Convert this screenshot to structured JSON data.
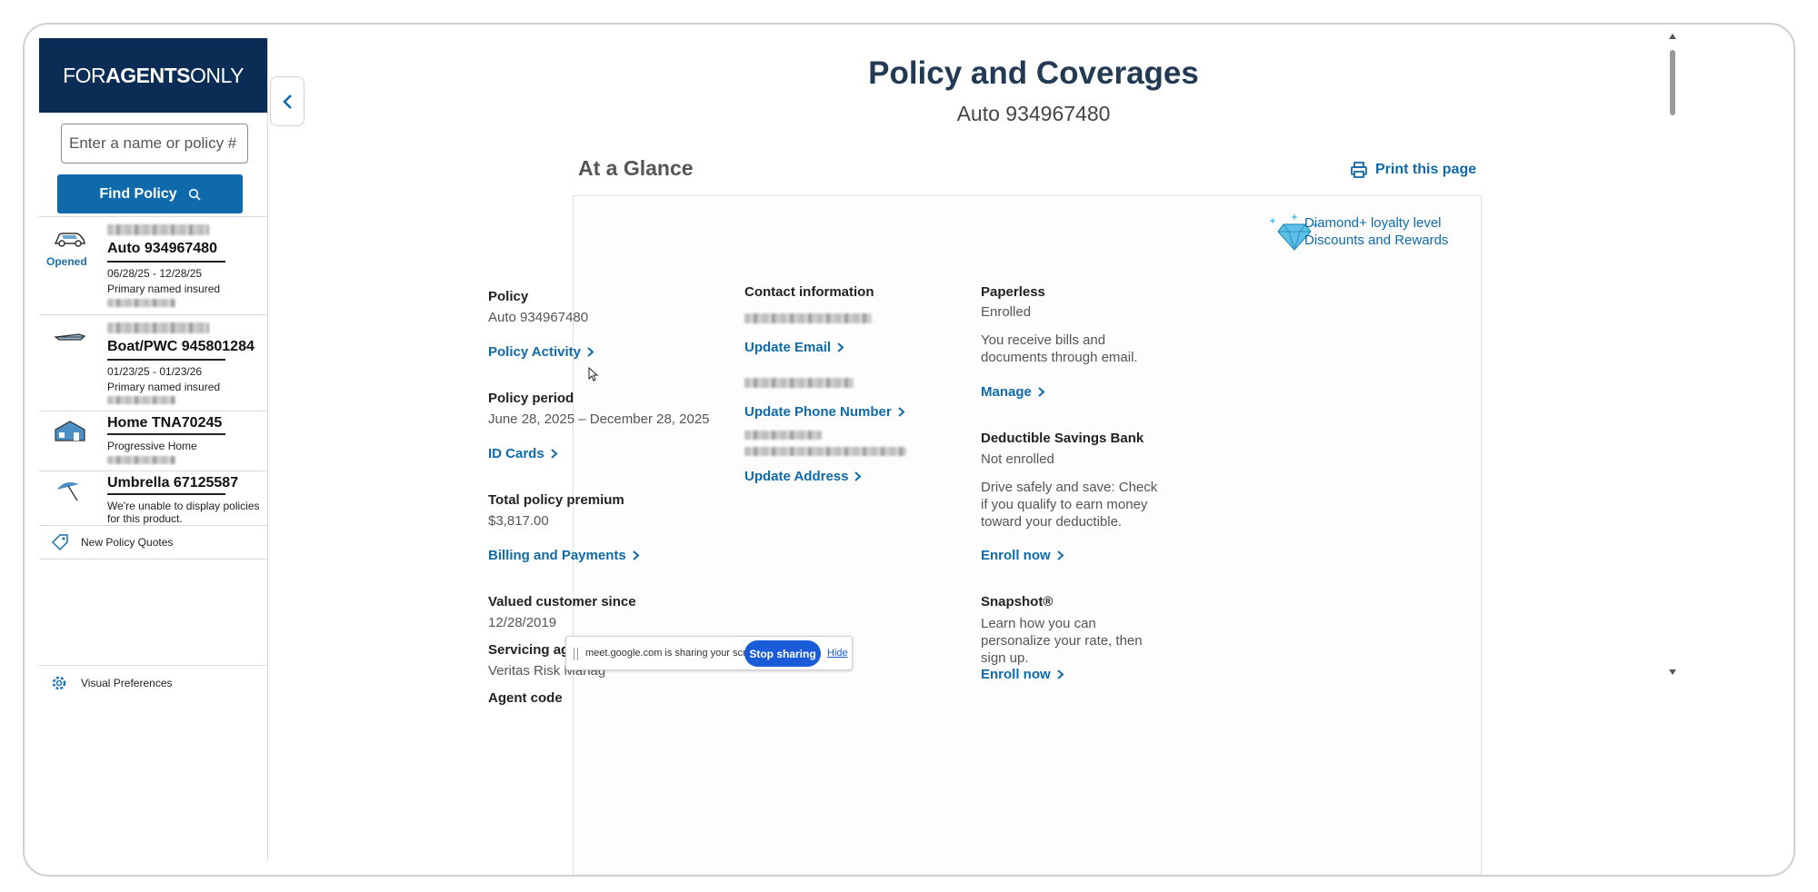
{
  "sidebar": {
    "logo": {
      "part1": "FOR",
      "part2": "AGENTS",
      "part3": "ONLY"
    },
    "search": {
      "placeholder": "Enter a name or policy #"
    },
    "find_button": "Find Policy",
    "policies": [
      {
        "title": "Auto 934967480",
        "status": "Opened",
        "dates": "06/28/25 - 12/28/25",
        "role": "Primary named insured",
        "icon": "car-icon"
      },
      {
        "title": "Boat/PWC 945801284",
        "dates": "01/23/25 - 01/23/26",
        "role": "Primary named insured",
        "icon": "boat-icon"
      },
      {
        "title": "Home TNA70245",
        "note": "Progressive Home",
        "icon": "house-icon"
      },
      {
        "title": "Umbrella 67125587",
        "note": "We're unable to display policies for this product.",
        "icon": "umbrella-icon"
      }
    ],
    "new_quotes": "New Policy Quotes",
    "visual_prefs": "Visual Preferences"
  },
  "main": {
    "title": "Policy and Coverages",
    "subtitle": "Auto 934967480",
    "section": "At a Glance",
    "print": "Print this page",
    "loyalty": {
      "line1": "Diamond+ loyalty level",
      "line2": "Discounts and Rewards"
    },
    "col1": {
      "policy_label": "Policy",
      "policy_value": "Auto 934967480",
      "policy_link": "Policy Activity",
      "period_label": "Policy period",
      "period_value": "June 28, 2025 – December 28, 2025",
      "period_link": "ID Cards",
      "premium_label": "Total policy premium",
      "premium_value": "$3,817.00",
      "premium_link": "Billing and Payments",
      "since_label": "Valued customer since",
      "since_value": "12/28/2019",
      "agent_label": "Servicing agent",
      "agent_value": "Veritas Risk Manag",
      "code_label": "Agent code"
    },
    "col2": {
      "contact_label": "Contact information",
      "email_link": "Update Email",
      "phone_link": "Update Phone Number",
      "address_link": "Update Address"
    },
    "col3": {
      "paperless_label": "Paperless",
      "paperless_value": "Enrolled",
      "paperless_desc": "You receive bills and documents through email.",
      "manage_link": "Manage",
      "dsb_label": "Deductible Savings Bank",
      "dsb_value": "Not enrolled",
      "dsb_desc": "Drive safely and save: Check if you qualify to earn money toward your deductible.",
      "dsb_link": "Enroll now",
      "snapshot_label": "Snapshot®",
      "snapshot_desc": "Learn how you can personalize your rate, then sign up.",
      "snapshot_link": "Enroll now"
    }
  },
  "share_bar": {
    "text": "meet.google.com is sharing your screen.",
    "stop": "Stop sharing",
    "hide": "Hide"
  }
}
